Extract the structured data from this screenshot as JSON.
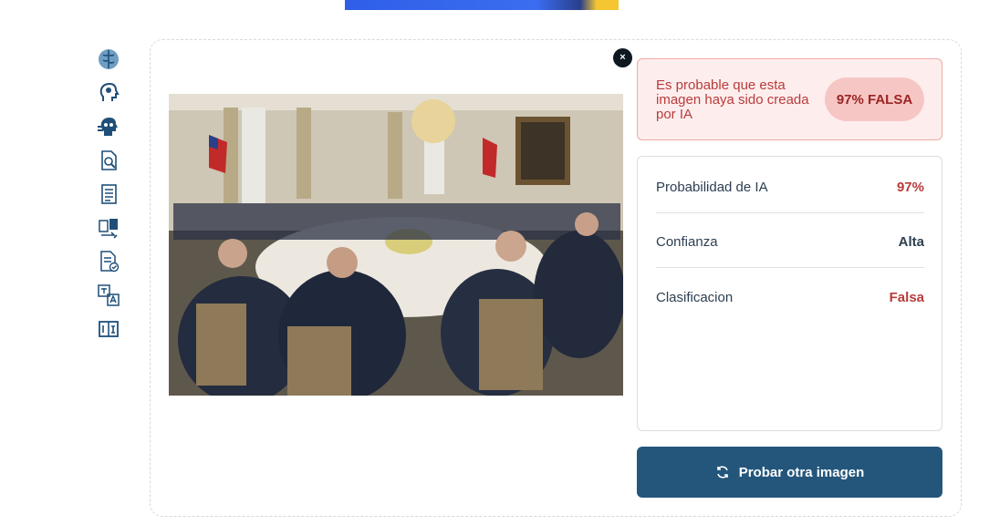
{
  "colors": {
    "accent": "#24567c",
    "danger": "#b93b3b",
    "danger_bg": "#fdeeed",
    "neutral_value": "#2c3e50"
  },
  "sidebar": {
    "items": [
      {
        "name": "brain-icon"
      },
      {
        "name": "head-ai-icon"
      },
      {
        "name": "robot-head-icon"
      },
      {
        "name": "document-search-icon"
      },
      {
        "name": "document-list-icon"
      },
      {
        "name": "document-transfer-icon"
      },
      {
        "name": "document-check-icon"
      },
      {
        "name": "translate-icon"
      },
      {
        "name": "compare-icon"
      }
    ]
  },
  "card": {
    "close_label": "×",
    "image_description": "Photo of a formal dinner in a hall with chandelier and Chilean flags"
  },
  "verdict": {
    "message": "Es probable que esta imagen haya sido creada por IA",
    "badge": "97% FALSA"
  },
  "stats": [
    {
      "label": "Probabilidad de IA",
      "value": "97%",
      "color": "#b93b3b"
    },
    {
      "label": "Confianza",
      "value": "Alta",
      "color": "#2c3e50"
    },
    {
      "label": "Clasificacion",
      "value": "Falsa",
      "color": "#b93b3b"
    }
  ],
  "actions": {
    "retry_label": "Probar otra imagen"
  }
}
